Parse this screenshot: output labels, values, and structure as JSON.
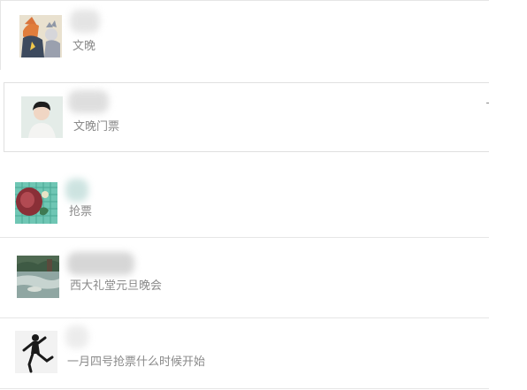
{
  "conversations": [
    {
      "message": "文晚",
      "avatar": "cartoon-fox-avatar"
    },
    {
      "message": "文晚门票",
      "avatar": "young-man-avatar"
    },
    {
      "message": "抢票",
      "avatar": "flower-lattice-avatar"
    },
    {
      "message": "西大礼堂元旦晚会",
      "avatar": "pond-landscape-avatar"
    },
    {
      "message": "一月四号抢票什么时候开始",
      "avatar": "dancing-figure-avatar"
    }
  ]
}
